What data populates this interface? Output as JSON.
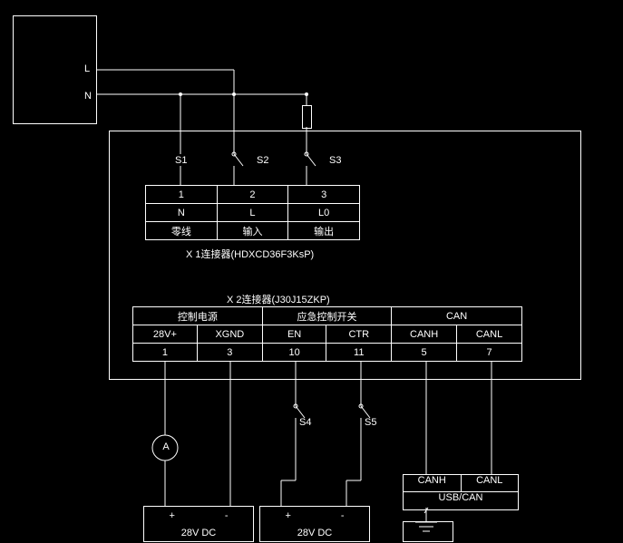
{
  "terminals": {
    "L": "L",
    "N": "N"
  },
  "switches": {
    "s1": "S1",
    "s2": "S2",
    "s3": "S3",
    "s4": "S4",
    "s5": "S5"
  },
  "x1": {
    "caption": "X 1连接器(HDXCD36F3KsP)",
    "row1": [
      "1",
      "2",
      "3"
    ],
    "row2": [
      "N",
      "L",
      "L0"
    ],
    "row3": [
      "零线",
      "输入",
      "输出"
    ]
  },
  "x2": {
    "caption": "X 2连接器(J30J15ZKP)",
    "headers": [
      "控制电源",
      "应急控制开关",
      "CAN"
    ],
    "row1": [
      "28V+",
      "XGND",
      "EN",
      "CTR",
      "CANH",
      "CANL"
    ],
    "row2": [
      "1",
      "3",
      "10",
      "11",
      "5",
      "7"
    ]
  },
  "ammeter": "A",
  "psu1": {
    "plus": "+",
    "minus": "-",
    "label": "28V DC"
  },
  "psu2": {
    "plus": "+",
    "minus": "-",
    "label": "28V DC"
  },
  "can_adapter": {
    "canh": "CANH",
    "canl": "CANL",
    "usb": "USB/CAN"
  },
  "chart_data": {
    "type": "table",
    "title": "Electrical wiring diagram: AC input + X1/X2 connectors + 28V DC supplies + CAN",
    "connectors": {
      "X1": {
        "part": "HDXCD36F3KsP",
        "pins": [
          {
            "pin": 1,
            "signal": "N",
            "desc": "零线"
          },
          {
            "pin": 2,
            "signal": "L",
            "desc": "输入"
          },
          {
            "pin": 3,
            "signal": "L0",
            "desc": "输出"
          }
        ]
      },
      "X2": {
        "part": "J30J15ZKP",
        "groups": [
          {
            "name": "控制电源",
            "pins": [
              {
                "pin": 1,
                "signal": "28V+"
              },
              {
                "pin": 3,
                "signal": "XGND"
              }
            ]
          },
          {
            "name": "应急控制开关",
            "pins": [
              {
                "pin": 10,
                "signal": "EN"
              },
              {
                "pin": 11,
                "signal": "CTR"
              }
            ]
          },
          {
            "name": "CAN",
            "pins": [
              {
                "pin": 5,
                "signal": "CANH"
              },
              {
                "pin": 7,
                "signal": "CANL"
              }
            ]
          }
        ]
      }
    },
    "switches": [
      "S1",
      "S2",
      "S3",
      "S4",
      "S5"
    ],
    "supplies": [
      {
        "name": "28V DC",
        "feeds": "X2 pin1/pin3 via ammeter A"
      },
      {
        "name": "28V DC",
        "feeds": "X2 pin10/pin11 via S4/S5"
      }
    ],
    "can_adapter": {
      "labels": [
        "CANH",
        "CANL"
      ],
      "type": "USB/CAN",
      "connects_to": [
        "X2 pin5",
        "X2 pin7"
      ]
    }
  }
}
